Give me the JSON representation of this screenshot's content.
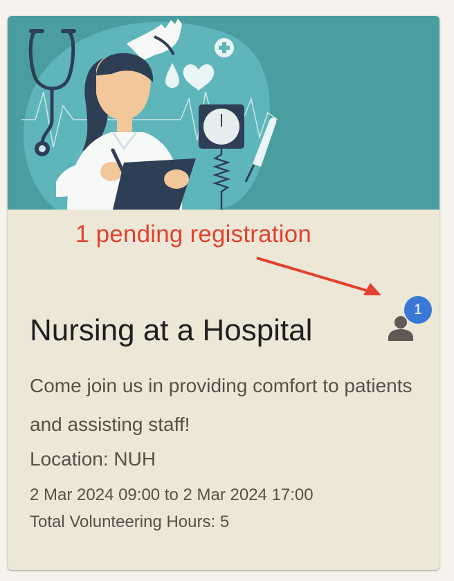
{
  "annotation": {
    "text": "1 pending registration",
    "color": "#e4402f"
  },
  "event": {
    "title": "Nursing at a Hospital",
    "description": "Come join us in providing comfort to patients and assisting staff!",
    "location": "Location: NUH",
    "dates": "2 Mar 2024 09:00 to 2 Mar 2024 17:00",
    "hours": "Total Volunteering Hours: 5"
  },
  "registrations": {
    "pending_count": "1",
    "icon": "person-icon",
    "badge_color": "#3a78d8"
  },
  "banner": {
    "icons": [
      "stethoscope-icon",
      "glove-icon",
      "heart-icon",
      "drop-icon",
      "medical-cross-icon",
      "blood-pressure-monitor-icon",
      "thermometer-icon",
      "clipboard-icon",
      "pen-icon"
    ],
    "background_color": "#4b9ea0"
  }
}
